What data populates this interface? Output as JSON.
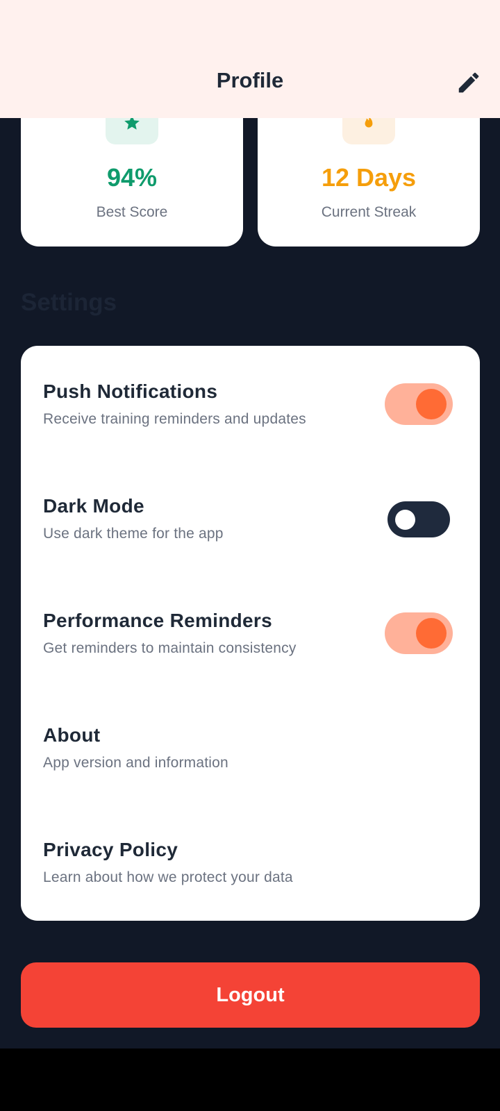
{
  "header": {
    "title": "Profile",
    "edit_icon": "pencil-icon"
  },
  "stats": [
    {
      "value": "94%",
      "label": "Best Score",
      "icon": "star-icon",
      "color": "#0f9b6c"
    },
    {
      "value": "12 Days",
      "label": "Current Streak",
      "icon": "flame-icon",
      "color": "#f59e0b"
    }
  ],
  "settings": {
    "section_title": "Settings",
    "items": [
      {
        "title": "Push Notifications",
        "subtitle": "Receive training reminders and updates",
        "toggle": "on"
      },
      {
        "title": "Dark Mode",
        "subtitle": "Use dark theme for the app",
        "toggle": "off"
      },
      {
        "title": "Performance Reminders",
        "subtitle": "Get reminders to maintain consistency",
        "toggle": "on"
      },
      {
        "title": "About",
        "subtitle": "App version and information"
      },
      {
        "title": "Privacy Policy",
        "subtitle": "Learn about how we protect your data"
      }
    ]
  },
  "logout_label": "Logout",
  "colors": {
    "accent": "#ff6b35",
    "accent_track": "#ffb199",
    "background": "#111827",
    "header_bg": "#fff1ee",
    "logout": "#f44336"
  }
}
